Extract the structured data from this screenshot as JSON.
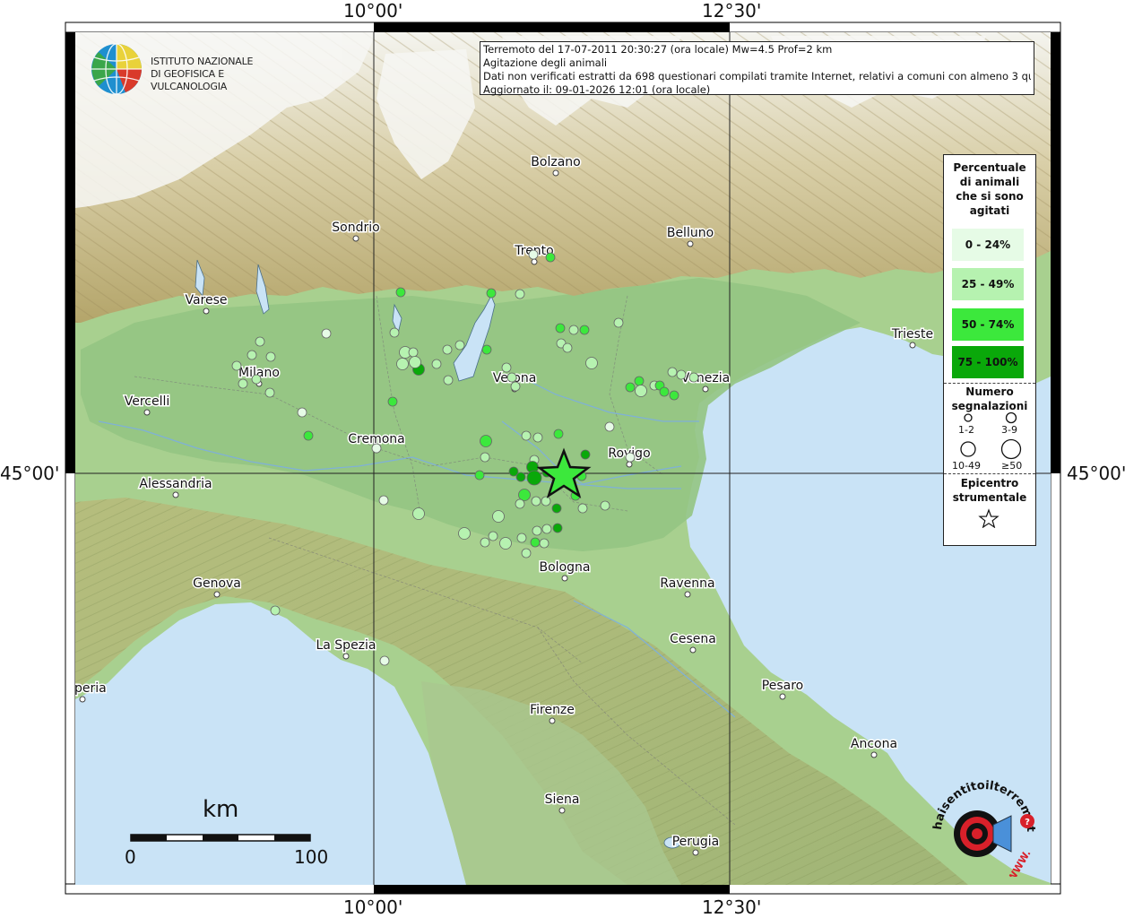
{
  "header": {
    "title_line1": "Terremoto del 17-07-2011 20:30:27 (ora locale) Mw=4.5 Prof=2 km",
    "title_line2": "Agitazione degli animali",
    "title_line3": "Dati non verificati estratti da 698 questionari compilati tramite Internet, relativi a comuni con almeno 3 questionari.",
    "title_line4": "Aggiornato il: 09-01-2026 12:01 (ora locale)"
  },
  "ingv_logo": {
    "line1": "ISTITUTO NAZIONALE",
    "line2": "DI GEOFISICA E VULCANOLOGIA"
  },
  "coords": {
    "top_left": "10°00'",
    "top_right": "12°30'",
    "bottom_left": "10°00'",
    "bottom_right": "12°30'",
    "left": "45°00'",
    "right": "45°00'"
  },
  "cities": [
    {
      "name": "Bolzano"
    },
    {
      "name": "Sondrio"
    },
    {
      "name": "Trento"
    },
    {
      "name": "Belluno"
    },
    {
      "name": "Varese"
    },
    {
      "name": "Trieste"
    },
    {
      "name": "Milano"
    },
    {
      "name": "Verona"
    },
    {
      "name": "Venezia"
    },
    {
      "name": "Vercelli"
    },
    {
      "name": "Cremona"
    },
    {
      "name": "Rovigo"
    },
    {
      "name": "Alessandria"
    },
    {
      "name": "Bologna"
    },
    {
      "name": "Genova"
    },
    {
      "name": "Ravenna"
    },
    {
      "name": "La Spezia"
    },
    {
      "name": "Cesena"
    },
    {
      "name": "Imperia"
    },
    {
      "name": "Pesaro"
    },
    {
      "name": "Firenze"
    },
    {
      "name": "Ancona"
    },
    {
      "name": "Siena"
    },
    {
      "name": "Perugia"
    }
  ],
  "legend": {
    "title": "Percentuale di animali che si sono agitati",
    "classes": [
      {
        "label": "0 - 24%",
        "color": "#e6fbe6"
      },
      {
        "label": "25 - 49%",
        "color": "#b6f2b0"
      },
      {
        "label": "50 - 74%",
        "color": "#3ce83c"
      },
      {
        "label": "75 - 100%",
        "color": "#0aa80a"
      }
    ],
    "count_title": "Numero segnalazioni",
    "count_classes": [
      "1-2",
      "3-9",
      "10-49",
      "≥50"
    ],
    "epicenter_title": "Epicentro strumentale"
  },
  "scale_bar": {
    "unit": "km",
    "min": "0",
    "max": "100"
  },
  "hst_logo": {
    "text": "haisentitoilterremoto.it",
    "url_text": "WWW."
  },
  "colors": {
    "sea": "#c8e2f5",
    "plain": "#9fcc8a",
    "hills": "#c2b27e",
    "grid": "#222222"
  },
  "epicenter": {
    "lon": 11.5,
    "lat": 45.0
  }
}
